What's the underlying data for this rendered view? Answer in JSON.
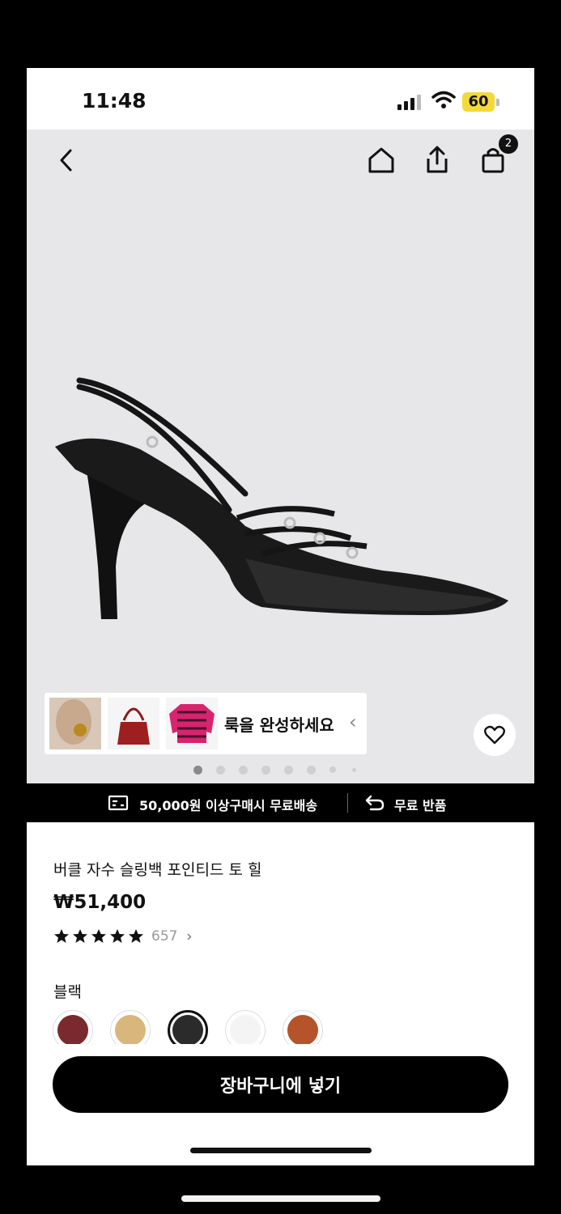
{
  "status_bar": {
    "time": "11:48",
    "battery": "60"
  },
  "header": {
    "bag_count": "2"
  },
  "look": {
    "label": "룩을 완성하세요"
  },
  "gallery": {
    "page_count": 8,
    "current_index": 0
  },
  "shipping": {
    "free_shipping_text": "50,000원 이상구매시 무료배송",
    "free_return_text": "무료 반품"
  },
  "product": {
    "name": "버클 자수 슬링백 포인티드 토 힐",
    "price": "₩51,400",
    "rating_stars": 5,
    "review_count": "657"
  },
  "color": {
    "selected_label": "블랙",
    "swatches": [
      "#7a2a2e",
      "#d9b67c",
      "#2b2b2b",
      "#f4f4f4",
      "#b5532a"
    ],
    "selected_index": 2
  },
  "actions": {
    "add_to_cart": "장바구니에 넣기"
  }
}
